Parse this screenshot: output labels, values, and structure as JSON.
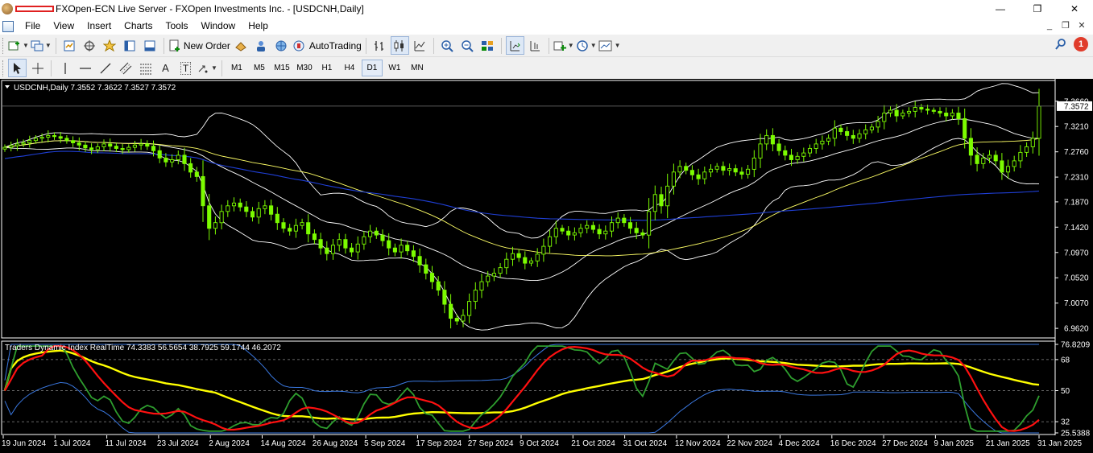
{
  "window": {
    "title": "FXOpen-ECN Live Server - FXOpen Investments Inc. - [USDCNH,Daily]",
    "minimize_glyph": "—",
    "maximize_glyph": "❐",
    "close_glyph": "✕"
  },
  "menu": {
    "items": [
      "File",
      "View",
      "Insert",
      "Charts",
      "Tools",
      "Window",
      "Help"
    ],
    "mdi_minimize": "_",
    "mdi_restore": "❐",
    "mdi_close": "✕"
  },
  "toolbar": {
    "new_order_label": "New Order",
    "autotrading_label": "AutoTrading",
    "notification_count": "1",
    "timeframes": [
      "M1",
      "M5",
      "M15",
      "M30",
      "H1",
      "H4",
      "D1",
      "W1",
      "MN"
    ],
    "active_timeframe": "D1",
    "text_tool_label": "A",
    "text_label_tool_label": "T"
  },
  "chart": {
    "header": "USDCNH,Daily  7.3552 7.3622 7.3527 7.3572",
    "current_price": "7.3572",
    "price_axis_labels": [
      "7.3660",
      "7.3210",
      "7.2760",
      "7.2310",
      "7.1870",
      "7.1420",
      "7.0970",
      "7.0520",
      "7.0070",
      "6.9620"
    ],
    "price_axis_values": [
      7.366,
      7.321,
      7.276,
      7.231,
      7.187,
      7.142,
      7.097,
      7.052,
      7.007,
      6.962
    ],
    "indicator_header": "Traders Dynamic Index RealTime 74.3383 56.5654 38.7925 59.1744 46.2072",
    "indicator_axis_labels": [
      "76.8209",
      "68",
      "50",
      "32",
      "25.5388"
    ],
    "indicator_axis_values": [
      76.8209,
      68,
      50,
      32,
      25.5388
    ],
    "date_labels": [
      "19 Jun 2024",
      "1 Jul 2024",
      "11 Jul 2024",
      "23 Jul 2024",
      "2 Aug 2024",
      "14 Aug 2024",
      "26 Aug 2024",
      "5 Sep 2024",
      "17 Sep 2024",
      "27 Sep 2024",
      "9 Oct 2024",
      "21 Oct 2024",
      "31 Oct 2024",
      "12 Nov 2024",
      "22 Nov 2024",
      "4 Dec 2024",
      "16 Dec 2024",
      "27 Dec 2024",
      "9 Jan 2025",
      "21 Jan 2025",
      "31 Jan 2025"
    ],
    "colors": {
      "background": "#000000",
      "candle": "#7CFC00",
      "bollinger": "#ffffff",
      "ma_slow": "#ffff66",
      "ma_long": "#1f3fd6",
      "tdi_green": "#2e9e2e",
      "tdi_red": "#ff1010",
      "tdi_yellow": "#ffff00",
      "tdi_band": "#3a78e0"
    }
  },
  "chart_data": {
    "type": "candlestick",
    "symbol": "USDCNH",
    "timeframe": "Daily",
    "ohlc_last": {
      "open": 7.3552,
      "high": 7.3622,
      "low": 7.3527,
      "close": 7.3572
    },
    "ylim": [
      6.955,
      7.38
    ],
    "closes_approx": [
      7.284,
      7.287,
      7.29,
      7.292,
      7.296,
      7.3,
      7.302,
      7.305,
      7.303,
      7.3,
      7.296,
      7.292,
      7.288,
      7.283,
      7.28,
      7.285,
      7.29,
      7.286,
      7.282,
      7.28,
      7.284,
      7.288,
      7.29,
      7.286,
      7.278,
      7.265,
      7.258,
      7.262,
      7.27,
      7.255,
      7.24,
      7.232,
      7.18,
      7.14,
      7.15,
      7.17,
      7.18,
      7.185,
      7.178,
      7.17,
      7.16,
      7.175,
      7.18,
      7.165,
      7.15,
      7.14,
      7.135,
      7.145,
      7.15,
      7.13,
      7.12,
      7.105,
      7.095,
      7.11,
      7.12,
      7.105,
      7.098,
      7.112,
      7.125,
      7.135,
      7.128,
      7.118,
      7.105,
      7.098,
      7.11,
      7.1,
      7.09,
      7.075,
      7.06,
      7.045,
      7.03,
      7.005,
      6.98,
      6.975,
      6.985,
      7.01,
      7.03,
      7.045,
      7.055,
      7.06,
      7.07,
      7.085,
      7.095,
      7.088,
      7.078,
      7.082,
      7.094,
      7.108,
      7.125,
      7.14,
      7.135,
      7.128,
      7.132,
      7.14,
      7.145,
      7.138,
      7.13,
      7.135,
      7.15,
      7.158,
      7.15,
      7.14,
      7.132,
      7.128,
      7.17,
      7.2,
      7.18,
      7.215,
      7.24,
      7.25,
      7.243,
      7.235,
      7.228,
      7.24,
      7.245,
      7.25,
      7.243,
      7.246,
      7.24,
      7.236,
      7.245,
      7.265,
      7.29,
      7.305,
      7.29,
      7.278,
      7.27,
      7.262,
      7.268,
      7.274,
      7.282,
      7.29,
      7.295,
      7.3,
      7.318,
      7.312,
      7.305,
      7.3,
      7.308,
      7.315,
      7.32,
      7.33,
      7.345,
      7.35,
      7.34,
      7.345,
      7.348,
      7.355,
      7.352,
      7.35,
      7.348,
      7.345,
      7.34,
      7.345,
      7.335,
      7.3,
      7.27,
      7.255,
      7.265,
      7.27,
      7.26,
      7.24,
      7.25,
      7.26,
      7.275,
      7.285,
      7.3,
      7.3572
    ],
    "indicators": [
      "Bollinger Bands (white)",
      "Moving Average (yellow)",
      "Moving Average (blue)"
    ],
    "subwindow": {
      "name": "Traders Dynamic Index RealTime",
      "values": [
        74.3383,
        56.5654,
        38.7925,
        59.1744,
        46.2072
      ],
      "levels": [
        68,
        50,
        32
      ],
      "ylim": [
        25.5388,
        76.8209
      ]
    }
  }
}
